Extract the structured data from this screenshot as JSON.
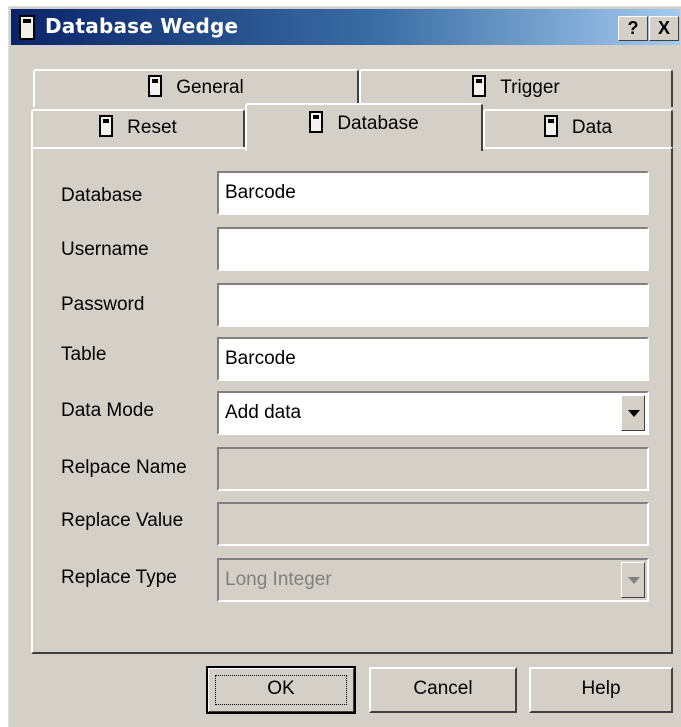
{
  "window": {
    "title": "Database Wedge",
    "help_button": "?",
    "close_button": "X"
  },
  "tabs": {
    "row_back": [
      {
        "label": "General"
      },
      {
        "label": "Trigger"
      }
    ],
    "row_front": [
      {
        "label": "Reset"
      },
      {
        "label": "Database"
      },
      {
        "label": "Data"
      }
    ],
    "selected": "Database"
  },
  "form": {
    "database": {
      "label": "Database",
      "value": "Barcode"
    },
    "username": {
      "label": "Username",
      "value": ""
    },
    "password": {
      "label": "Password",
      "value": ""
    },
    "table": {
      "label": "Table",
      "value": "Barcode"
    },
    "data_mode": {
      "label": "Data Mode",
      "value": "Add data"
    },
    "replace_name": {
      "label": "Relpace Name",
      "value": ""
    },
    "replace_value": {
      "label": "Replace Value",
      "value": ""
    },
    "replace_type": {
      "label": "Replace Type",
      "value": "Long Integer"
    }
  },
  "buttons": {
    "ok": "OK",
    "cancel": "Cancel",
    "help": "Help"
  },
  "colors": {
    "dialog_face": "#d4d0c8",
    "title_start": "#0a246a",
    "title_end": "#a6caf0",
    "disabled_text": "#808080"
  }
}
